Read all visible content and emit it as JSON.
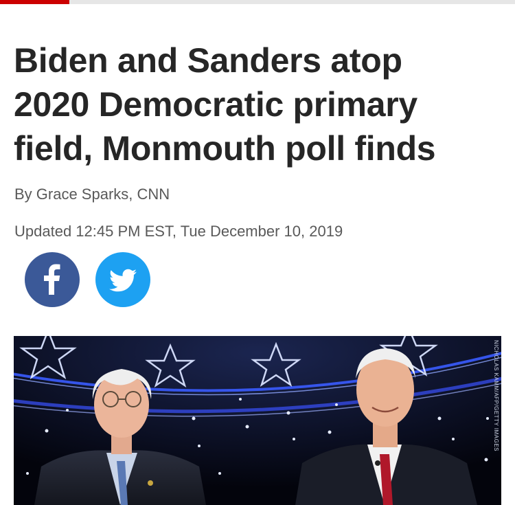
{
  "progress": {
    "fraction": 0.134,
    "track_color": "#e6e6e6",
    "fill_color": "#cc0000"
  },
  "article": {
    "headline_lines": [
      "Biden and Sanders atop",
      "2020 Democratic primary",
      "field, Monmouth poll finds"
    ],
    "byline": "By Grace Sparks, CNN",
    "updated": "Updated 12:45 PM EST, Tue December 10, 2019"
  },
  "share": {
    "facebook": {
      "icon": "facebook-icon",
      "color": "#3b5998"
    },
    "twitter": {
      "icon": "twitter-icon",
      "color": "#1da1f2"
    }
  },
  "hero_image": {
    "credit": "NICHOLAS KAMM/AFP/GETTY IMAGES"
  }
}
